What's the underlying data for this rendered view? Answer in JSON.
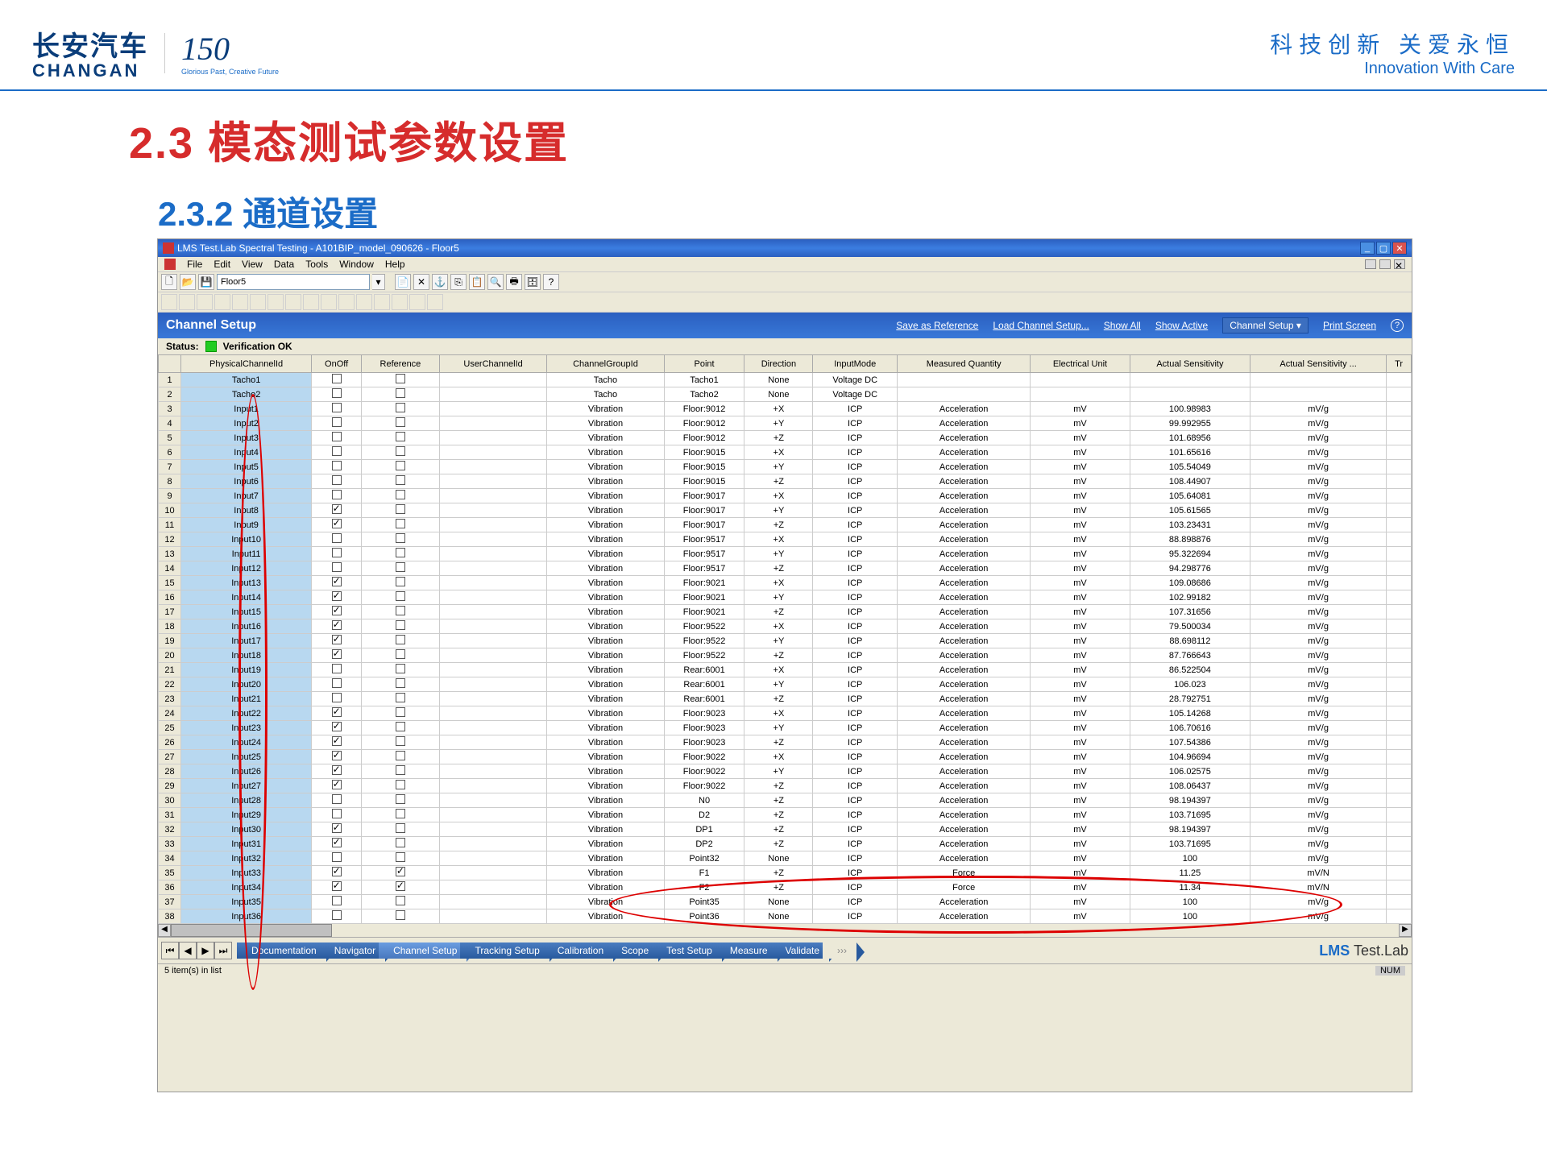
{
  "header": {
    "logo_cn": "长安汽车",
    "logo_en": "CHANGAN",
    "logo_150": "150",
    "logo_sub": "Glorious Past, Creative Future",
    "slogan_cn": "科技创新  关爱永恒",
    "slogan_en": "Innovation With Care"
  },
  "titles": {
    "h23": "2.3 模态测试参数设置",
    "h232": "2.3.2 通道设置"
  },
  "window": {
    "title": "LMS Test.Lab Spectral Testing - A101BIP_model_090626 - Floor5",
    "menus": [
      "File",
      "Edit",
      "View",
      "Data",
      "Tools",
      "Window",
      "Help"
    ],
    "section": "Floor5"
  },
  "panel": {
    "title": "Channel Setup",
    "links": {
      "save": "Save as Reference",
      "load": "Load Channel Setup...",
      "all": "Show All",
      "active": "Show Active"
    },
    "dropdown": "Channel Setup ▾",
    "print": "Print Screen",
    "status_label": "Status:",
    "status_text": "Verification OK"
  },
  "columns": [
    "PhysicalChannelId",
    "OnOff",
    "Reference",
    "UserChannelId",
    "ChannelGroupId",
    "Point",
    "Direction",
    "InputMode",
    "Measured Quantity",
    "Electrical Unit",
    "Actual Sensitivity",
    "Actual Sensitivity ...",
    "Tr"
  ],
  "rows": [
    {
      "n": 1,
      "id": "Tacho1",
      "on": false,
      "ref": false,
      "grp": "Tacho",
      "pt": "Tacho1",
      "dir": "None",
      "mode": "Voltage DC",
      "mq": "",
      "eu": "",
      "as": "",
      "asu": ""
    },
    {
      "n": 2,
      "id": "Tacho2",
      "on": false,
      "ref": false,
      "grp": "Tacho",
      "pt": "Tacho2",
      "dir": "None",
      "mode": "Voltage DC",
      "mq": "",
      "eu": "",
      "as": "",
      "asu": ""
    },
    {
      "n": 3,
      "id": "Input1",
      "on": false,
      "ref": false,
      "grp": "Vibration",
      "pt": "Floor:9012",
      "dir": "+X",
      "mode": "ICP",
      "mq": "Acceleration",
      "eu": "mV",
      "as": "100.98983",
      "asu": "mV/g"
    },
    {
      "n": 4,
      "id": "Input2",
      "on": false,
      "ref": false,
      "grp": "Vibration",
      "pt": "Floor:9012",
      "dir": "+Y",
      "mode": "ICP",
      "mq": "Acceleration",
      "eu": "mV",
      "as": "99.992955",
      "asu": "mV/g"
    },
    {
      "n": 5,
      "id": "Input3",
      "on": false,
      "ref": false,
      "grp": "Vibration",
      "pt": "Floor:9012",
      "dir": "+Z",
      "mode": "ICP",
      "mq": "Acceleration",
      "eu": "mV",
      "as": "101.68956",
      "asu": "mV/g"
    },
    {
      "n": 6,
      "id": "Input4",
      "on": false,
      "ref": false,
      "grp": "Vibration",
      "pt": "Floor:9015",
      "dir": "+X",
      "mode": "ICP",
      "mq": "Acceleration",
      "eu": "mV",
      "as": "101.65616",
      "asu": "mV/g"
    },
    {
      "n": 7,
      "id": "Input5",
      "on": false,
      "ref": false,
      "grp": "Vibration",
      "pt": "Floor:9015",
      "dir": "+Y",
      "mode": "ICP",
      "mq": "Acceleration",
      "eu": "mV",
      "as": "105.54049",
      "asu": "mV/g"
    },
    {
      "n": 8,
      "id": "Input6",
      "on": false,
      "ref": false,
      "grp": "Vibration",
      "pt": "Floor:9015",
      "dir": "+Z",
      "mode": "ICP",
      "mq": "Acceleration",
      "eu": "mV",
      "as": "108.44907",
      "asu": "mV/g"
    },
    {
      "n": 9,
      "id": "Input7",
      "on": false,
      "ref": false,
      "grp": "Vibration",
      "pt": "Floor:9017",
      "dir": "+X",
      "mode": "ICP",
      "mq": "Acceleration",
      "eu": "mV",
      "as": "105.64081",
      "asu": "mV/g"
    },
    {
      "n": 10,
      "id": "Input8",
      "on": true,
      "ref": false,
      "grp": "Vibration",
      "pt": "Floor:9017",
      "dir": "+Y",
      "mode": "ICP",
      "mq": "Acceleration",
      "eu": "mV",
      "as": "105.61565",
      "asu": "mV/g"
    },
    {
      "n": 11,
      "id": "Input9",
      "on": true,
      "ref": false,
      "grp": "Vibration",
      "pt": "Floor:9017",
      "dir": "+Z",
      "mode": "ICP",
      "mq": "Acceleration",
      "eu": "mV",
      "as": "103.23431",
      "asu": "mV/g"
    },
    {
      "n": 12,
      "id": "Input10",
      "on": false,
      "ref": false,
      "grp": "Vibration",
      "pt": "Floor:9517",
      "dir": "+X",
      "mode": "ICP",
      "mq": "Acceleration",
      "eu": "mV",
      "as": "88.898876",
      "asu": "mV/g"
    },
    {
      "n": 13,
      "id": "Input11",
      "on": false,
      "ref": false,
      "grp": "Vibration",
      "pt": "Floor:9517",
      "dir": "+Y",
      "mode": "ICP",
      "mq": "Acceleration",
      "eu": "mV",
      "as": "95.322694",
      "asu": "mV/g"
    },
    {
      "n": 14,
      "id": "Input12",
      "on": false,
      "ref": false,
      "grp": "Vibration",
      "pt": "Floor:9517",
      "dir": "+Z",
      "mode": "ICP",
      "mq": "Acceleration",
      "eu": "mV",
      "as": "94.298776",
      "asu": "mV/g"
    },
    {
      "n": 15,
      "id": "Input13",
      "on": true,
      "ref": false,
      "grp": "Vibration",
      "pt": "Floor:9021",
      "dir": "+X",
      "mode": "ICP",
      "mq": "Acceleration",
      "eu": "mV",
      "as": "109.08686",
      "asu": "mV/g"
    },
    {
      "n": 16,
      "id": "Input14",
      "on": true,
      "ref": false,
      "grp": "Vibration",
      "pt": "Floor:9021",
      "dir": "+Y",
      "mode": "ICP",
      "mq": "Acceleration",
      "eu": "mV",
      "as": "102.99182",
      "asu": "mV/g"
    },
    {
      "n": 17,
      "id": "Input15",
      "on": true,
      "ref": false,
      "grp": "Vibration",
      "pt": "Floor:9021",
      "dir": "+Z",
      "mode": "ICP",
      "mq": "Acceleration",
      "eu": "mV",
      "as": "107.31656",
      "asu": "mV/g"
    },
    {
      "n": 18,
      "id": "Input16",
      "on": true,
      "ref": false,
      "grp": "Vibration",
      "pt": "Floor:9522",
      "dir": "+X",
      "mode": "ICP",
      "mq": "Acceleration",
      "eu": "mV",
      "as": "79.500034",
      "asu": "mV/g"
    },
    {
      "n": 19,
      "id": "Input17",
      "on": true,
      "ref": false,
      "grp": "Vibration",
      "pt": "Floor:9522",
      "dir": "+Y",
      "mode": "ICP",
      "mq": "Acceleration",
      "eu": "mV",
      "as": "88.698112",
      "asu": "mV/g"
    },
    {
      "n": 20,
      "id": "Input18",
      "on": true,
      "ref": false,
      "grp": "Vibration",
      "pt": "Floor:9522",
      "dir": "+Z",
      "mode": "ICP",
      "mq": "Acceleration",
      "eu": "mV",
      "as": "87.766643",
      "asu": "mV/g"
    },
    {
      "n": 21,
      "id": "Input19",
      "on": false,
      "ref": false,
      "grp": "Vibration",
      "pt": "Rear:6001",
      "dir": "+X",
      "mode": "ICP",
      "mq": "Acceleration",
      "eu": "mV",
      "as": "86.522504",
      "asu": "mV/g"
    },
    {
      "n": 22,
      "id": "Input20",
      "on": false,
      "ref": false,
      "grp": "Vibration",
      "pt": "Rear:6001",
      "dir": "+Y",
      "mode": "ICP",
      "mq": "Acceleration",
      "eu": "mV",
      "as": "106.023",
      "asu": "mV/g"
    },
    {
      "n": 23,
      "id": "Input21",
      "on": false,
      "ref": false,
      "grp": "Vibration",
      "pt": "Rear:6001",
      "dir": "+Z",
      "mode": "ICP",
      "mq": "Acceleration",
      "eu": "mV",
      "as": "28.792751",
      "asu": "mV/g"
    },
    {
      "n": 24,
      "id": "Input22",
      "on": true,
      "ref": false,
      "grp": "Vibration",
      "pt": "Floor:9023",
      "dir": "+X",
      "mode": "ICP",
      "mq": "Acceleration",
      "eu": "mV",
      "as": "105.14268",
      "asu": "mV/g"
    },
    {
      "n": 25,
      "id": "Input23",
      "on": true,
      "ref": false,
      "grp": "Vibration",
      "pt": "Floor:9023",
      "dir": "+Y",
      "mode": "ICP",
      "mq": "Acceleration",
      "eu": "mV",
      "as": "106.70616",
      "asu": "mV/g"
    },
    {
      "n": 26,
      "id": "Input24",
      "on": true,
      "ref": false,
      "grp": "Vibration",
      "pt": "Floor:9023",
      "dir": "+Z",
      "mode": "ICP",
      "mq": "Acceleration",
      "eu": "mV",
      "as": "107.54386",
      "asu": "mV/g"
    },
    {
      "n": 27,
      "id": "Input25",
      "on": true,
      "ref": false,
      "grp": "Vibration",
      "pt": "Floor:9022",
      "dir": "+X",
      "mode": "ICP",
      "mq": "Acceleration",
      "eu": "mV",
      "as": "104.96694",
      "asu": "mV/g"
    },
    {
      "n": 28,
      "id": "Input26",
      "on": true,
      "ref": false,
      "grp": "Vibration",
      "pt": "Floor:9022",
      "dir": "+Y",
      "mode": "ICP",
      "mq": "Acceleration",
      "eu": "mV",
      "as": "106.02575",
      "asu": "mV/g"
    },
    {
      "n": 29,
      "id": "Input27",
      "on": true,
      "ref": false,
      "grp": "Vibration",
      "pt": "Floor:9022",
      "dir": "+Z",
      "mode": "ICP",
      "mq": "Acceleration",
      "eu": "mV",
      "as": "108.06437",
      "asu": "mV/g"
    },
    {
      "n": 30,
      "id": "Input28",
      "on": false,
      "ref": false,
      "grp": "Vibration",
      "pt": "N0",
      "dir": "+Z",
      "mode": "ICP",
      "mq": "Acceleration",
      "eu": "mV",
      "as": "98.194397",
      "asu": "mV/g"
    },
    {
      "n": 31,
      "id": "Input29",
      "on": false,
      "ref": false,
      "grp": "Vibration",
      "pt": "D2",
      "dir": "+Z",
      "mode": "ICP",
      "mq": "Acceleration",
      "eu": "mV",
      "as": "103.71695",
      "asu": "mV/g"
    },
    {
      "n": 32,
      "id": "Input30",
      "on": true,
      "ref": false,
      "grp": "Vibration",
      "pt": "DP1",
      "dir": "+Z",
      "mode": "ICP",
      "mq": "Acceleration",
      "eu": "mV",
      "as": "98.194397",
      "asu": "mV/g"
    },
    {
      "n": 33,
      "id": "Input31",
      "on": true,
      "ref": false,
      "grp": "Vibration",
      "pt": "DP2",
      "dir": "+Z",
      "mode": "ICP",
      "mq": "Acceleration",
      "eu": "mV",
      "as": "103.71695",
      "asu": "mV/g"
    },
    {
      "n": 34,
      "id": "Input32",
      "on": false,
      "ref": false,
      "grp": "Vibration",
      "pt": "Point32",
      "dir": "None",
      "mode": "ICP",
      "mq": "Acceleration",
      "eu": "mV",
      "as": "100",
      "asu": "mV/g"
    },
    {
      "n": 35,
      "id": "Input33",
      "on": true,
      "ref": true,
      "grp": "Vibration",
      "pt": "F1",
      "dir": "+Z",
      "mode": "ICP",
      "mq": "Force",
      "eu": "mV",
      "as": "11.25",
      "asu": "mV/N"
    },
    {
      "n": 36,
      "id": "Input34",
      "on": true,
      "ref": true,
      "grp": "Vibration",
      "pt": "F2",
      "dir": "+Z",
      "mode": "ICP",
      "mq": "Force",
      "eu": "mV",
      "as": "11.34",
      "asu": "mV/N"
    },
    {
      "n": 37,
      "id": "Input35",
      "on": false,
      "ref": false,
      "grp": "Vibration",
      "pt": "Point35",
      "dir": "None",
      "mode": "ICP",
      "mq": "Acceleration",
      "eu": "mV",
      "as": "100",
      "asu": "mV/g"
    },
    {
      "n": 38,
      "id": "Input36",
      "on": false,
      "ref": false,
      "grp": "Vibration",
      "pt": "Point36",
      "dir": "None",
      "mode": "ICP",
      "mq": "Acceleration",
      "eu": "mV",
      "as": "100",
      "asu": "mV/g"
    }
  ],
  "nav": {
    "steps": [
      "Documentation",
      "Navigator",
      "Channel Setup",
      "Tracking Setup",
      "Calibration",
      "Scope",
      "Test Setup",
      "Measure",
      "Validate"
    ],
    "active": 2,
    "brand": "LMS Test.Lab"
  },
  "status_bar": {
    "left": "5 item(s) in list",
    "right": "NUM"
  }
}
